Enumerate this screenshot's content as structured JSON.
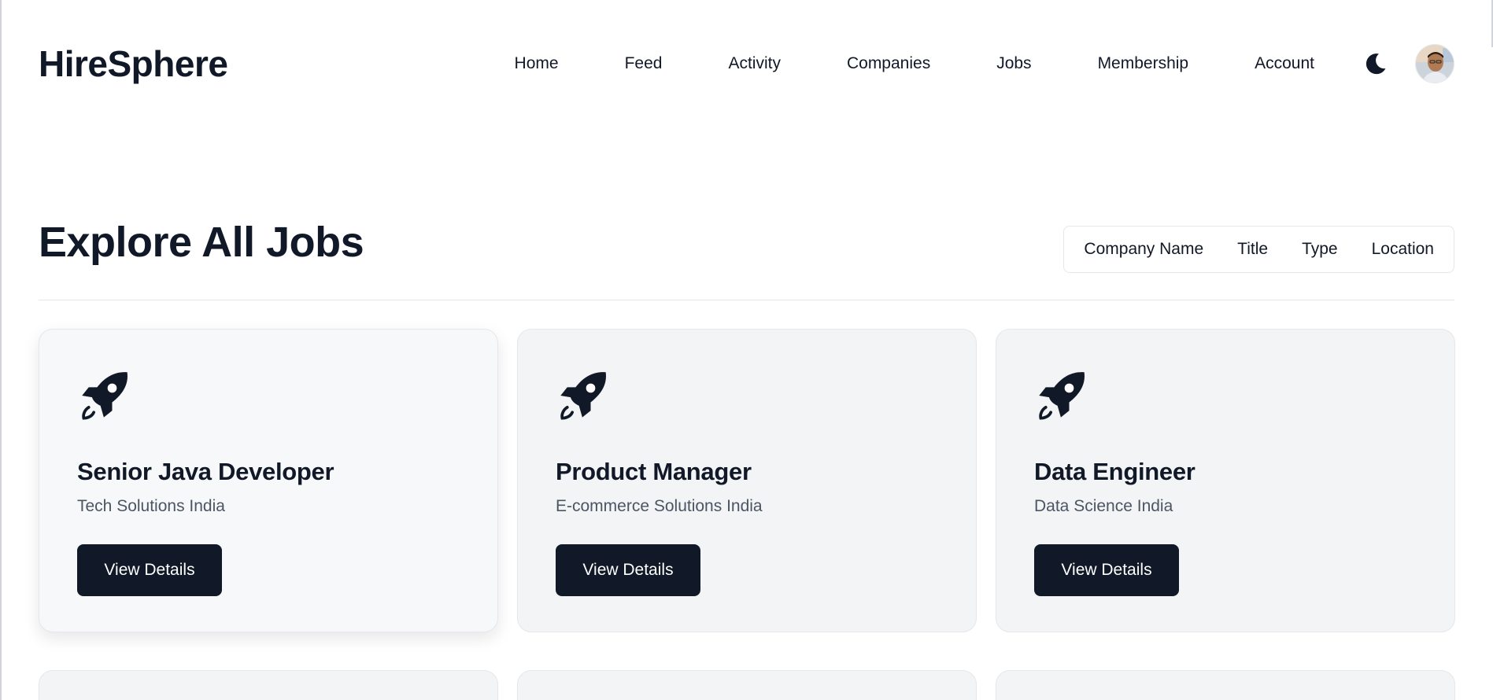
{
  "app": {
    "brand": "HireSphere"
  },
  "nav": {
    "items": [
      {
        "label": "Home"
      },
      {
        "label": "Feed"
      },
      {
        "label": "Activity"
      },
      {
        "label": "Companies"
      },
      {
        "label": "Jobs"
      },
      {
        "label": "Membership"
      },
      {
        "label": "Account"
      }
    ],
    "theme_icon": "moon-icon",
    "avatar_icon": "user-avatar"
  },
  "page": {
    "title": "Explore All Jobs",
    "filters": [
      "Company Name",
      "Title",
      "Type",
      "Location"
    ]
  },
  "jobs": [
    {
      "icon": "rocket-icon",
      "title": "Senior Java Developer",
      "company": "Tech Solutions India",
      "button": "View Details"
    },
    {
      "icon": "rocket-icon",
      "title": "Product Manager",
      "company": "E-commerce Solutions India",
      "button": "View Details"
    },
    {
      "icon": "rocket-icon",
      "title": "Data Engineer",
      "company": "Data Science India",
      "button": "View Details"
    }
  ],
  "colors": {
    "primary": "#111827",
    "muted_text": "#4b5563",
    "card_bg": "#f3f4f6",
    "border": "#e5e7eb"
  }
}
